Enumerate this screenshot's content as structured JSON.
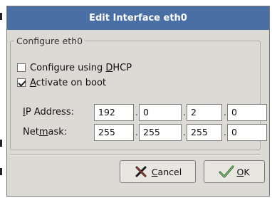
{
  "dialog": {
    "title": "Edit Interface eth0",
    "group_title": "Configure eth0",
    "dhcp": {
      "label_pre": "Configure using ",
      "label_mnemonic": "D",
      "label_post": "HCP",
      "checked": false
    },
    "boot": {
      "label_mnemonic": "A",
      "label_post": "ctivate on boot",
      "checked": true
    },
    "ip": {
      "label_mnemonic": "I",
      "label_post": "P Address:",
      "octets": [
        "192",
        "0",
        "2",
        "0"
      ]
    },
    "netmask": {
      "label_pre": "Net",
      "label_mnemonic": "m",
      "label_post": "ask:",
      "octets": [
        "255",
        "255",
        "255",
        "0"
      ]
    },
    "cancel": {
      "label_mnemonic": "C",
      "label_post": "ancel"
    },
    "ok": {
      "label_mnemonic": "O",
      "label_post": "K"
    }
  },
  "colors": {
    "titlebar": "#4a6fa5",
    "dialog_bg": "#dcdad5",
    "entry_bg": "#ffffff"
  },
  "icons": {
    "cancel": "x-mark-icon",
    "ok": "checkmark-hand-icon"
  }
}
